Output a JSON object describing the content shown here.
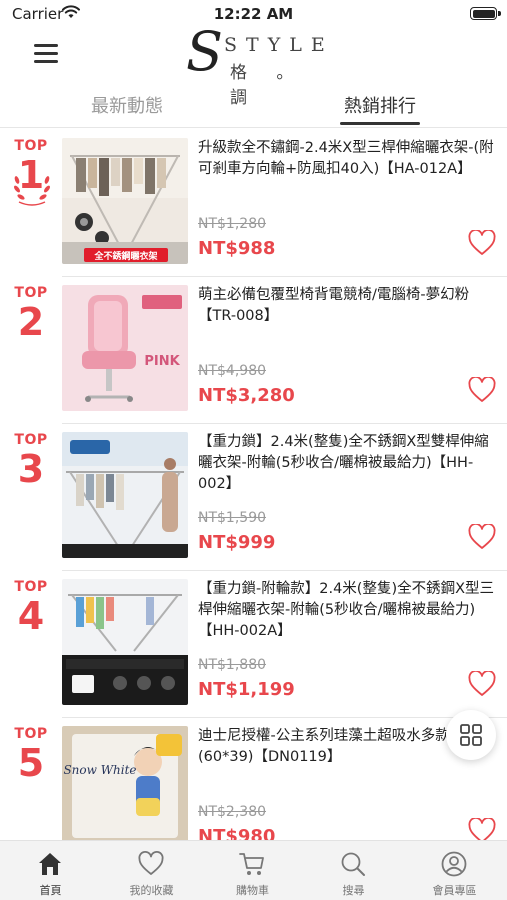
{
  "status_bar": {
    "carrier": "Carrier",
    "time": "12:22 AM"
  },
  "header": {
    "logo": {
      "initial": "S",
      "word": "STYLE",
      "sub": "格 。調"
    }
  },
  "tabs": [
    {
      "label": "最新動態",
      "active": false
    },
    {
      "label": "熱銷排行",
      "active": true
    }
  ],
  "rank_prefix": "TOP",
  "products": [
    {
      "rank": "1",
      "title": "升級款全不鏽鋼-2.4米X型三桿伸縮曬衣架-(附可剎車方向輪+防風扣40入)【HA-012A】",
      "old_price": "NT$1,280",
      "price": "NT$988",
      "thumb_caption": "全不銹鋼曬衣架"
    },
    {
      "rank": "2",
      "title": "萌主必備包覆型椅背電競椅/電腦椅-夢幻粉【TR-008】",
      "old_price": "NT$4,980",
      "price": "NT$3,280",
      "thumb_caption": "PINK"
    },
    {
      "rank": "3",
      "title": "【重力鎖】2.4米(整隻)全不銹鋼X型雙桿伸縮曬衣架-附輪(5秒收合/曬棉被最給力)【HH-002】",
      "old_price": "NT$1,590",
      "price": "NT$999",
      "thumb_caption": ""
    },
    {
      "rank": "4",
      "title": "【重力鎖-附輪款】2.4米(整隻)全不銹鋼X型三桿伸縮曬衣架-附輪(5秒收合/曬棉被最給力)【HH-002A】",
      "old_price": "NT$1,880",
      "price": "NT$1,199",
      "thumb_caption": ""
    },
    {
      "rank": "5",
      "title": "迪士尼授權-公主系列珪藻土超吸水多款選擇(60*39)【DN0119】",
      "old_price": "NT$2,380",
      "price": "NT$980",
      "thumb_caption": "Snow White"
    }
  ],
  "bottom_tabs": [
    {
      "label": "首頁",
      "icon": "home-icon",
      "active": true
    },
    {
      "label": "我的收藏",
      "icon": "heart-icon",
      "active": false
    },
    {
      "label": "購物車",
      "icon": "cart-icon",
      "active": false
    },
    {
      "label": "搜尋",
      "icon": "search-icon",
      "active": false
    },
    {
      "label": "會員專區",
      "icon": "user-icon",
      "active": false
    }
  ],
  "colors": {
    "accent": "#e8474c",
    "text": "#222222",
    "muted": "#9a9a9a",
    "tabbar": "#f3f3f3"
  }
}
